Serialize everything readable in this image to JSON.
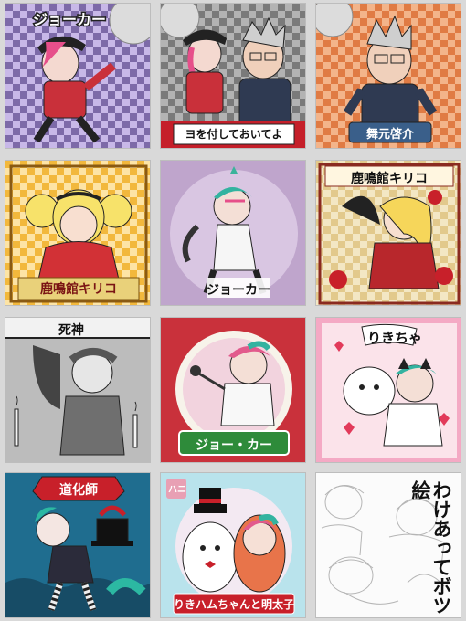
{
  "cards": {
    "c1": {
      "label": "ジョーカー"
    },
    "c2": {
      "banner": "ヨを付しておいてよ"
    },
    "c3": {
      "banner": "舞元啓介"
    },
    "c4": {
      "banner": "鹿鳴館キリコ"
    },
    "c5": {
      "label": "ジョーカー"
    },
    "c6": {
      "label": "鹿鳴館キリコ"
    },
    "c7": {
      "label": "死神"
    },
    "c8": {
      "banner": "ジョー・カー"
    },
    "c9": {
      "label": "りきちゃ"
    },
    "c10": {
      "banner": "道化師"
    },
    "c11": {
      "banner": "りきハムちゃんと明太子",
      "tag": "ハニ"
    },
    "c12": {
      "vertical": "わけあってボツ絵"
    }
  },
  "colors": {
    "purple_check": "#8a7bb0",
    "orange_check": "#e8874a",
    "green_check": "#a7d26a",
    "gold": "#f2c04a",
    "red_banner": "#d0242b",
    "gray": "#9b9b9b"
  }
}
